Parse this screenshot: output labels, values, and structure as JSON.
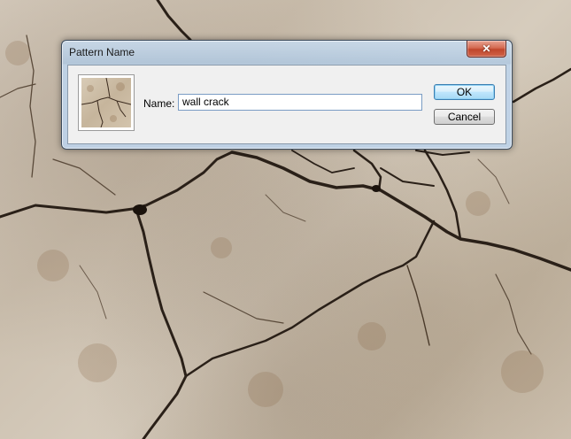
{
  "background": {
    "icon": "cracked-wall-texture"
  },
  "dialog": {
    "title": "Pattern Name",
    "close_icon": "close-icon",
    "thumbnail_icon": "pattern-preview-thumbnail",
    "name_label": "Name:",
    "name_value": "wall crack",
    "ok_label": "OK",
    "cancel_label": "Cancel"
  },
  "colors": {
    "close_button": "#c0462c",
    "ok_button_border": "#3c7fb1",
    "input_border": "#7a9cc4"
  }
}
